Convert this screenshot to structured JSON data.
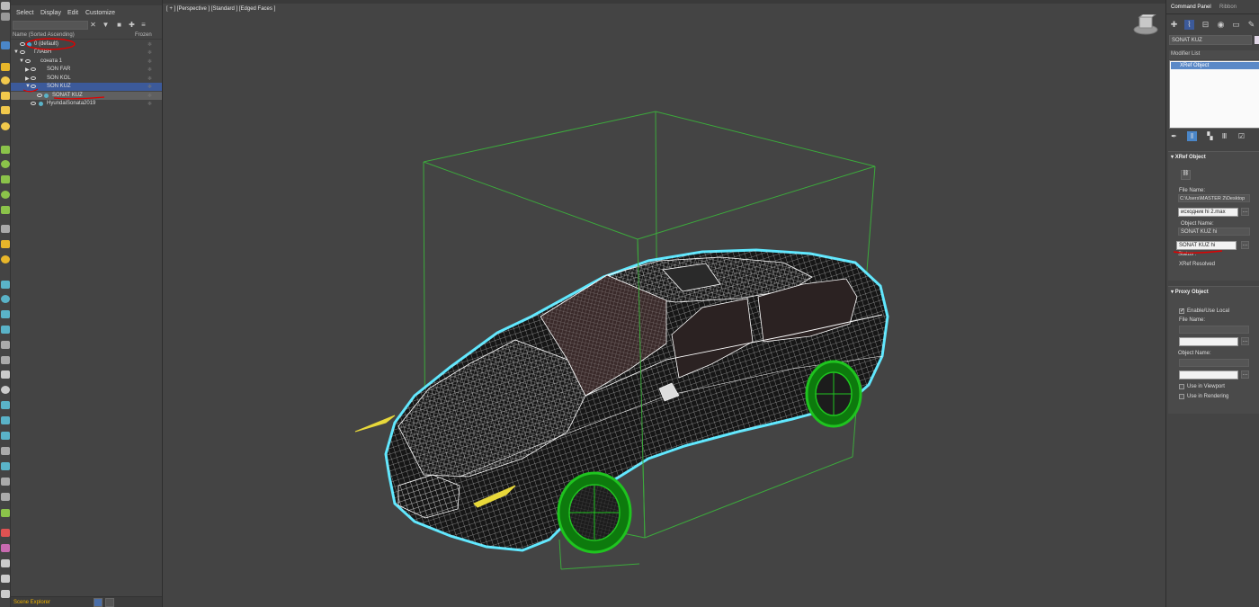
{
  "scene_explorer": {
    "menu": [
      "Select",
      "Display",
      "Edit",
      "Customize"
    ],
    "columns": {
      "name": "Name (Sorted Ascending)",
      "frozen": "Frozen"
    },
    "tree": [
      {
        "label": "0 (default)"
      },
      {
        "label": "ГЛАВН"
      },
      {
        "label": "соната 1"
      },
      {
        "label": "SON FAR"
      },
      {
        "label": "SON KOL"
      },
      {
        "label": "SON KUZ"
      },
      {
        "label": "SONAT KUZ"
      },
      {
        "label": "HyundaiSonata2019"
      }
    ],
    "bottom_label": "Scene Explorer"
  },
  "viewport": {
    "label": "[ + ] [Perspective ] [Standard ] [Edged Faces ]"
  },
  "command_panel": {
    "tabs": [
      "Command Panel",
      "Ribbon"
    ],
    "object_name": "SONAT KUZ",
    "modifier_list_label": "Modifier List",
    "stack_item": "XRef Object",
    "xref": {
      "title": "XRef Object",
      "file_name_label": "File Name:",
      "file_path": "C:\\Users\\MASTER 2\\Desktop",
      "file_name_value": "исходник hi 2.max",
      "object_name_label": "Object Name:",
      "object_name_display": "SONAT KUZ hi",
      "object_name_value": "SONAT KUZ hi",
      "status_label": "Status :",
      "status_value": "XRef Resolved"
    },
    "proxy": {
      "title": "Proxy Object",
      "enable_label": "Enable/Use Local",
      "file_name_label": "File Name:",
      "object_name_label": "Object Name:",
      "use_viewport_label": "Use in Viewport",
      "use_rendering_label": "Use in Rendering"
    }
  },
  "colors": {
    "ui_bg": "#444444",
    "selection_blue": "#3c5a9a",
    "wireframe": "#ffffff",
    "outline": "#4fe8ff",
    "bbox": "#3caa3c",
    "wheels": "#1fc41f",
    "lights": "#e8d83a",
    "annotation_red": "#e00000",
    "explorer_label": "#f0b400"
  }
}
